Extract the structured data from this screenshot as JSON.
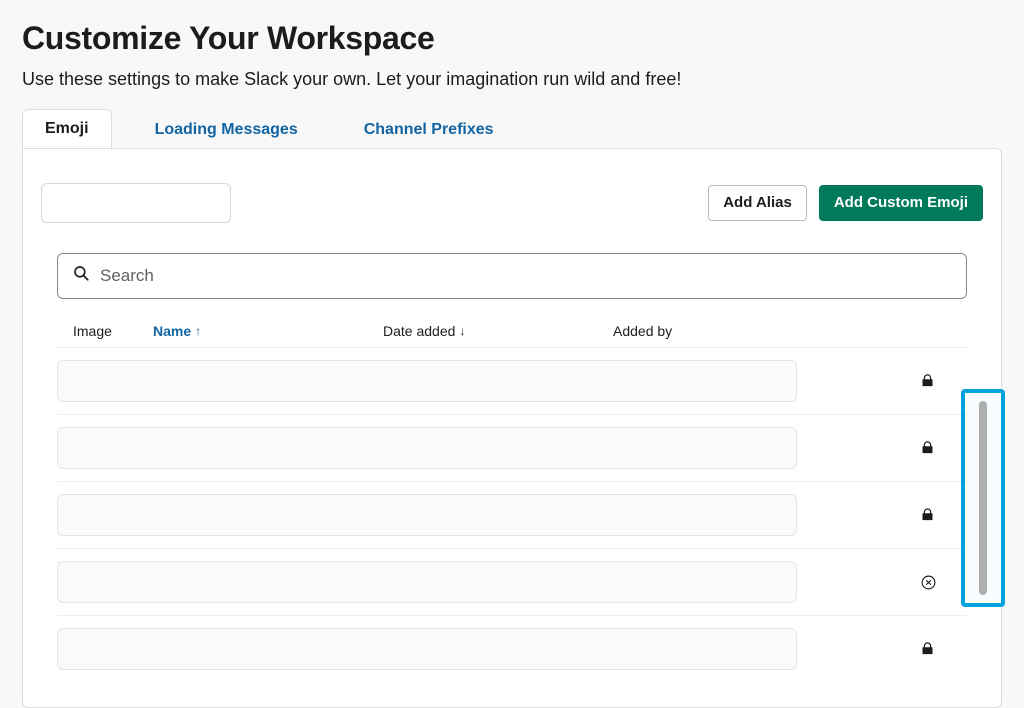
{
  "header": {
    "title": "Customize Your Workspace",
    "subtitle": "Use these settings to make Slack your own. Let your imagination run wild and free!"
  },
  "tabs": [
    {
      "label": "Emoji",
      "active": true
    },
    {
      "label": "Loading Messages",
      "active": false
    },
    {
      "label": "Channel Prefixes",
      "active": false
    }
  ],
  "toolbar": {
    "add_alias_label": "Add Alias",
    "add_emoji_label": "Add Custom Emoji"
  },
  "search": {
    "placeholder": "Search"
  },
  "columns": {
    "image": "Image",
    "name": "Name",
    "date_added": "Date added",
    "added_by": "Added by",
    "name_sort_arrow": "↑",
    "date_sort_arrow": "↓"
  },
  "rows": [
    {
      "action": "lock"
    },
    {
      "action": "lock"
    },
    {
      "action": "lock"
    },
    {
      "action": "delete"
    },
    {
      "action": "lock"
    }
  ]
}
